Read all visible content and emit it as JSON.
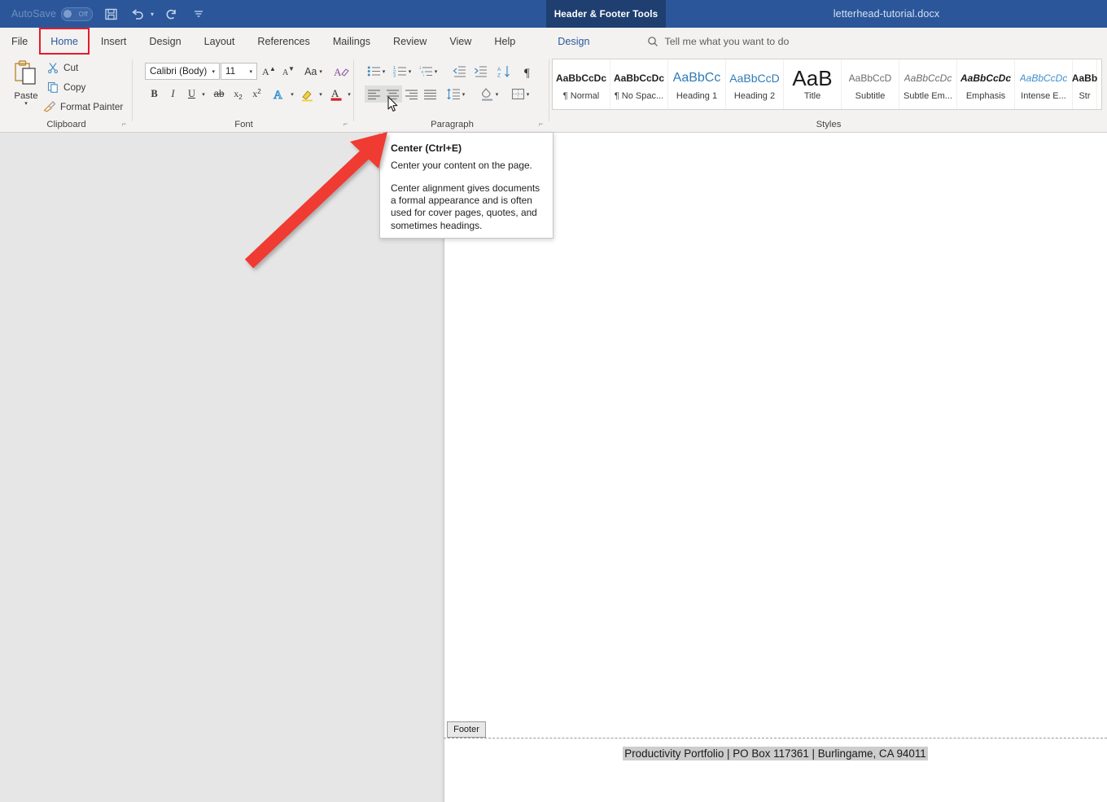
{
  "titlebar": {
    "autosave_label": "AutoSave",
    "autosave_state": "Off",
    "save_icon": "save-icon",
    "undo_icon": "undo-icon",
    "redo_icon": "redo-icon",
    "customize_icon": "customize-qat-icon",
    "context_tab": "Header & Footer Tools",
    "document_title": "letterhead-tutorial.docx",
    "bg_color": "#2b579a",
    "context_tab_color": "#1e3f70"
  },
  "tabs": [
    {
      "label": "File",
      "selected": false,
      "contextual": false
    },
    {
      "label": "Home",
      "selected": true,
      "contextual": false
    },
    {
      "label": "Insert",
      "selected": false,
      "contextual": false
    },
    {
      "label": "Design",
      "selected": false,
      "contextual": false
    },
    {
      "label": "Layout",
      "selected": false,
      "contextual": false
    },
    {
      "label": "References",
      "selected": false,
      "contextual": false
    },
    {
      "label": "Mailings",
      "selected": false,
      "contextual": false
    },
    {
      "label": "Review",
      "selected": false,
      "contextual": false
    },
    {
      "label": "View",
      "selected": false,
      "contextual": false
    },
    {
      "label": "Help",
      "selected": false,
      "contextual": false
    },
    {
      "label": "Design",
      "selected": false,
      "contextual": true
    }
  ],
  "search": {
    "placeholder": "Tell me what you want to do",
    "icon": "search-icon"
  },
  "ribbon": {
    "selection_highlight_color": "#e8192c",
    "groups": [
      {
        "name": "Clipboard",
        "label": "Clipboard",
        "paste_label": "Paste",
        "items": [
          {
            "label": "Cut",
            "icon": "scissors-icon"
          },
          {
            "label": "Copy",
            "icon": "copy-icon"
          },
          {
            "label": "Format Painter",
            "icon": "paintbrush-icon"
          }
        ],
        "dialog_launcher": "dialog-launcher-icon"
      },
      {
        "name": "Font",
        "label": "Font",
        "font_family_value": "Calibri (Body)",
        "font_size_value": "11",
        "buttons": [
          {
            "name": "grow-font",
            "label": "A"
          },
          {
            "name": "shrink-font",
            "label": "A"
          },
          {
            "name": "change-case",
            "label": "Aa"
          },
          {
            "name": "clear-formatting",
            "label": "A"
          },
          {
            "name": "bold",
            "label": "B"
          },
          {
            "name": "italic",
            "label": "I"
          },
          {
            "name": "underline",
            "label": "U"
          },
          {
            "name": "strikethrough",
            "label": "ab"
          },
          {
            "name": "subscript",
            "label": "x"
          },
          {
            "name": "superscript",
            "label": "x"
          },
          {
            "name": "text-effects",
            "label": "A"
          },
          {
            "name": "text-highlight",
            "label": "A"
          },
          {
            "name": "font-color",
            "label": "A"
          }
        ],
        "dialog_launcher": "dialog-launcher-icon"
      },
      {
        "name": "Paragraph",
        "label": "Paragraph",
        "buttons": [
          {
            "name": "bullets",
            "pressed": false
          },
          {
            "name": "numbering",
            "pressed": false
          },
          {
            "name": "multilevel-list",
            "pressed": false
          },
          {
            "name": "decrease-indent",
            "pressed": false
          },
          {
            "name": "increase-indent",
            "pressed": false
          },
          {
            "name": "sort",
            "pressed": false
          },
          {
            "name": "show-formatting-marks",
            "pressed": false
          },
          {
            "name": "align-left",
            "pressed": true
          },
          {
            "name": "align-center",
            "pressed": true
          },
          {
            "name": "align-right",
            "pressed": false
          },
          {
            "name": "justify",
            "pressed": false
          },
          {
            "name": "line-spacing",
            "pressed": false
          },
          {
            "name": "shading",
            "pressed": false
          },
          {
            "name": "borders",
            "pressed": false
          }
        ],
        "dialog_launcher": "dialog-launcher-icon"
      },
      {
        "name": "Styles",
        "label": "Styles",
        "gallery": [
          {
            "preview": "AaBbCcDc",
            "name": "¶ Normal"
          },
          {
            "preview": "AaBbCcDc",
            "name": "¶ No Spac..."
          },
          {
            "preview": "AaBbCc",
            "name": "Heading 1"
          },
          {
            "preview": "AaBbCcD",
            "name": "Heading 2"
          },
          {
            "preview": "AaB",
            "name": "Title"
          },
          {
            "preview": "AaBbCcD",
            "name": "Subtitle"
          },
          {
            "preview": "AaBbCcDc",
            "name": "Subtle Em..."
          },
          {
            "preview": "AaBbCcDc",
            "name": "Emphasis"
          },
          {
            "preview": "AaBbCcDc",
            "name": "Intense E..."
          },
          {
            "preview": "AaBb",
            "name": "Str"
          }
        ]
      }
    ]
  },
  "tooltip": {
    "title": "Center (Ctrl+E)",
    "summary": "Center your content on the page.",
    "body": "Center alignment gives documents a formal appearance and is often used for cover pages, quotes, and sometimes headings."
  },
  "document": {
    "footer_tab_label": "Footer",
    "footer_text": "Productivity Portfolio | PO Box 117361 | Burlingame, CA 94011",
    "page_background": "#ffffff",
    "canvas_background": "#e6e6e6"
  },
  "annotation": {
    "arrow_color": "#ef3b33",
    "arrow_from": "bottom-left",
    "arrow_to": "center-alignment-button"
  }
}
